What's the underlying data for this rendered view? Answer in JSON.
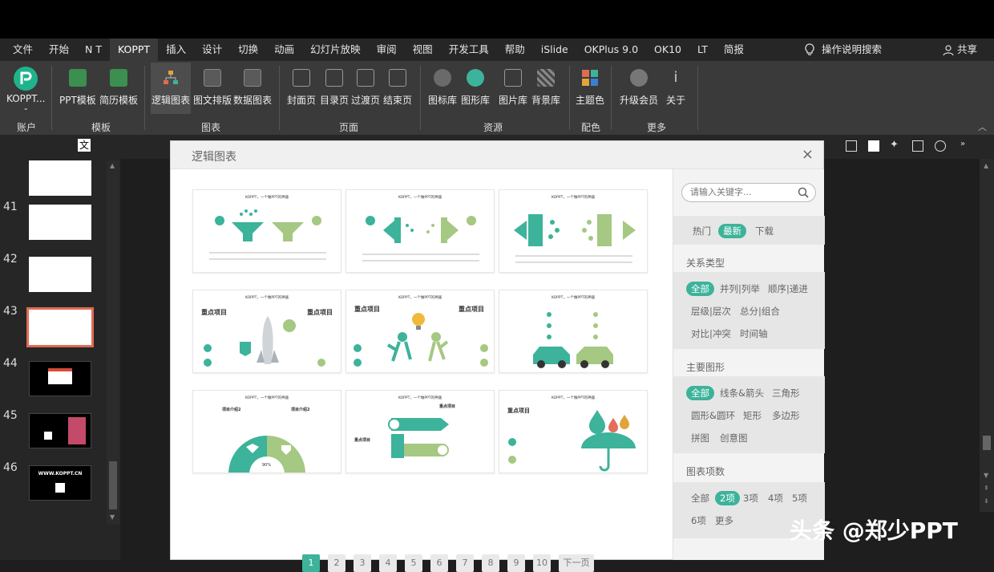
{
  "tabs": [
    "文件",
    "开始",
    "N T",
    "KOPPT",
    "插入",
    "设计",
    "切换",
    "动画",
    "幻灯片放映",
    "审阅",
    "视图",
    "开发工具",
    "帮助",
    "iSlide",
    "OKPlus 9.0",
    "OK10",
    "LT",
    "简报"
  ],
  "active_tab": "KOPPT",
  "help_label": "操作说明搜索",
  "share_label": "共享",
  "ribbon": {
    "account": {
      "button": "KOPPT...",
      "group": "账户"
    },
    "template": {
      "buttons": [
        "PPT模板",
        "简历模板"
      ],
      "group": "模板"
    },
    "chart": {
      "buttons": [
        "逻辑图表",
        "图文排版",
        "数据图表"
      ],
      "group": "图表"
    },
    "page": {
      "buttons": [
        "封面页",
        "目录页",
        "过渡页",
        "结束页"
      ],
      "group": "页面"
    },
    "resource": {
      "buttons": [
        "图标库",
        "图形库",
        "图片库",
        "背景库"
      ],
      "group": "资源"
    },
    "color": {
      "buttons": [
        "主题色"
      ],
      "group": "配色"
    },
    "more": {
      "buttons": [
        "升级会员",
        "关于"
      ],
      "group": "更多"
    }
  },
  "slides": {
    "numbers": [
      "41",
      "42",
      "43",
      "44",
      "45",
      "46"
    ],
    "text_46": "WWW.KOPPT.CN"
  },
  "dialog": {
    "title": "逻辑图表",
    "close": "×",
    "card_title": "KOPPT，一个做PPT的神器",
    "card_labels": {
      "key_project": "重点项目",
      "intro2": "项目介绍2",
      "percent": "90%"
    },
    "pages": [
      "1",
      "2",
      "3",
      "4",
      "5",
      "6",
      "7",
      "8",
      "9",
      "10"
    ],
    "next_label": "下一页",
    "search_placeholder": "请输入关键字...",
    "sort": [
      "热门",
      "最新",
      "下载"
    ],
    "relation_title": "关系类型",
    "relation": [
      "全部",
      "并列|列举",
      "顺序|递进",
      "层级|层次",
      "总分|组合",
      "对比|冲突",
      "时间轴"
    ],
    "shape_title": "主要图形",
    "shape": [
      "全部",
      "线条&箭头",
      "三角形",
      "圆形&圆环",
      "矩形",
      "多边形",
      "拼图",
      "创意图"
    ],
    "count_title": "图表项数",
    "count": [
      "全部",
      "2项",
      "3项",
      "4项",
      "5项",
      "6项",
      "更多"
    ]
  },
  "watermark": "头条 @郑少PPT",
  "colors": {
    "accent": "#3cb39a",
    "light_green": "#a5c882",
    "selection": "#e06b55"
  }
}
